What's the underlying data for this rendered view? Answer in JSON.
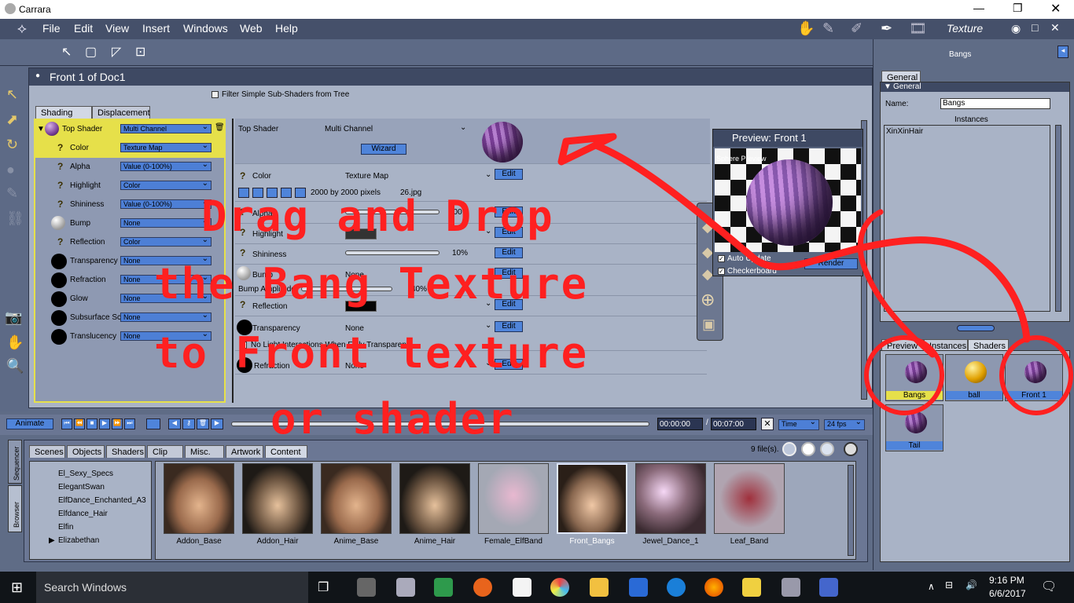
{
  "window": {
    "title": "Carrara"
  },
  "menu": [
    "File",
    "Edit",
    "View",
    "Insert",
    "Windows",
    "Web",
    "Help"
  ],
  "room": "Texture",
  "document": {
    "title": "Front 1 of Doc1",
    "filter_label": "Filter Simple Sub-Shaders from Tree"
  },
  "tabs": {
    "shading": "Shading",
    "displacement": "Displacement"
  },
  "tree": [
    {
      "label": "Top Shader",
      "value": "Multi Channel"
    },
    {
      "label": "Color",
      "value": "Texture Map"
    },
    {
      "label": "Alpha",
      "value": "Value (0-100%)"
    },
    {
      "label": "Highlight",
      "value": "Color"
    },
    {
      "label": "Shininess",
      "value": "Value (0-100%)"
    },
    {
      "label": "Bump",
      "value": "None"
    },
    {
      "label": "Reflection",
      "value": "Color"
    },
    {
      "label": "Transparency",
      "value": "None"
    },
    {
      "label": "Refraction",
      "value": "None"
    },
    {
      "label": "Glow",
      "value": "None"
    },
    {
      "label": "Subsurface Sc",
      "value": "None"
    },
    {
      "label": "Translucency",
      "value": "None"
    }
  ],
  "detail": {
    "top_shader_label": "Top Shader",
    "top_shader_value": "Multi Channel",
    "wizard": "Wizard",
    "edit": "Edit",
    "color": {
      "label": "Color",
      "value": "Texture Map",
      "size": "2000 by 2000 pixels",
      "file": "26.jpg"
    },
    "alpha": {
      "label": "Alpha",
      "value": "100"
    },
    "highlight": {
      "label": "Highlight"
    },
    "shininess": {
      "label": "Shininess",
      "value": "10%"
    },
    "bump": {
      "label": "Bump",
      "value": "None"
    },
    "bump_amp": {
      "label": "Bump Amplitude",
      "value": "40%"
    },
    "reflection": {
      "label": "Reflection"
    },
    "transparency": {
      "label": "Transparency",
      "value": "None"
    },
    "no_light": "No Light Interactions When Fully Transparent",
    "refraction": {
      "label": "Refraction",
      "value": "None"
    }
  },
  "preview": {
    "title": "Preview: Front 1",
    "sphere_label": "Sphere Preview",
    "auto_update": "Auto Update",
    "checkerboard": "Checkerboard",
    "render": "Render"
  },
  "right": {
    "title": "Bangs",
    "general_tab": "General",
    "general_section": "General",
    "name_label": "Name:",
    "name_value": "Bangs",
    "instances_label": "Instances",
    "instances": [
      "XinXinHair"
    ],
    "tabs": [
      "Preview",
      "Instances",
      "Shaders"
    ],
    "shaders": [
      "Bangs",
      "ball",
      "Front 1",
      "Tail"
    ]
  },
  "timeline": {
    "animate": "Animate",
    "time_start": "00:00:00",
    "time_end": "00:07:00",
    "time_mode": "Time",
    "fps": "24 fps"
  },
  "browser": {
    "side_tabs": [
      "Sequencer",
      "Browser"
    ],
    "tabs": [
      "Scenes",
      "Objects",
      "Shaders",
      "Clip",
      "Misc.",
      "Artwork",
      "Content"
    ],
    "file_count": "9 file(s).",
    "folders": [
      "El_Sexy_Specs",
      "ElegantSwan",
      "ElfDance_Enchanted_A3",
      "Elfdance_Hair",
      "Elfin",
      "Elizabethan"
    ],
    "items": [
      "Addon_Base",
      "Addon_Hair",
      "Anime_Base",
      "Anime_Hair",
      "Female_ElfBand",
      "Front_Bangs",
      "Jewel_Dance_1",
      "Leaf_Band"
    ]
  },
  "overlay_text": [
    "Drag and Drop",
    "the Bang Texture",
    "to Front texture",
    "or shader"
  ],
  "taskbar": {
    "search": "Search Windows",
    "time": "9:16 PM",
    "date": "6/6/2017"
  },
  "colors": {
    "accent": "#4f84da",
    "highlight": "#e6e04a",
    "annotation": "#ff2020"
  }
}
